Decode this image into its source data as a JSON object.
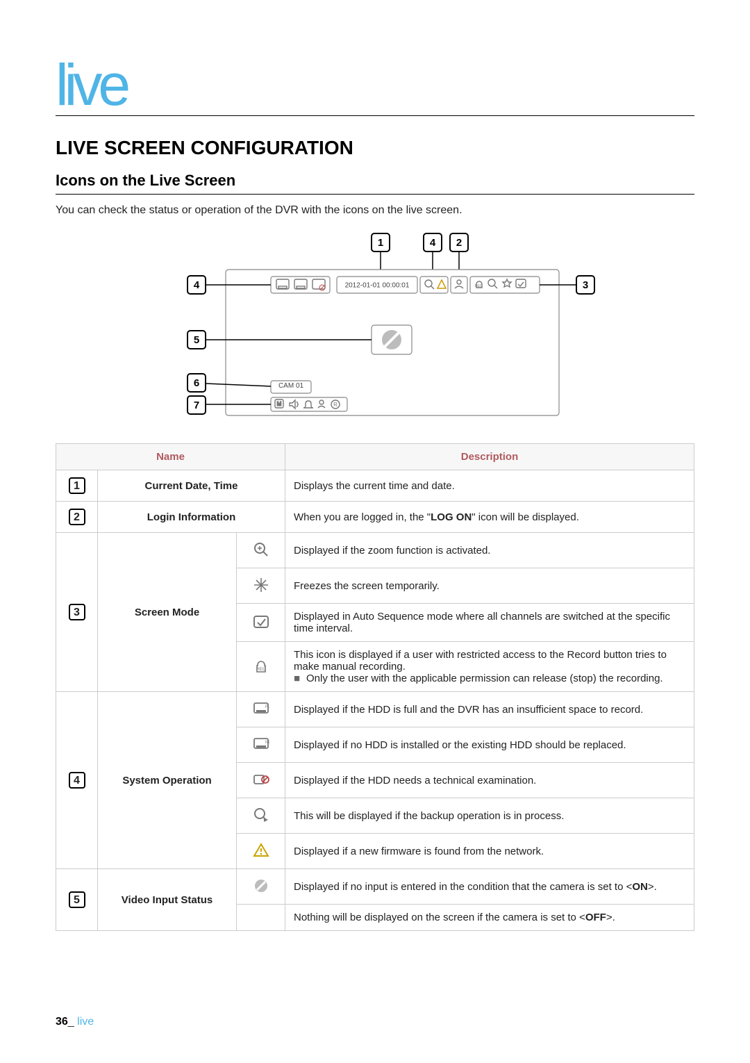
{
  "page": {
    "header": "live",
    "section_title": "LIVE SCREEN CONFIGURATION",
    "sub_title": "Icons on the Live Screen",
    "intro": "You can check the status or operation of the DVR with the icons on the live screen.",
    "footer_page": "36",
    "footer_sep": "_",
    "footer_label": "live"
  },
  "diagram": {
    "callout_1": "1",
    "callout_2": "2",
    "callout_3": "3",
    "callout_4_top": "4",
    "callout_4_left": "4",
    "callout_5": "5",
    "callout_6": "6",
    "callout_7": "7",
    "date_time": "2012-01-01  00:00:01",
    "cam_label": "CAM 01"
  },
  "table": {
    "head_name": "Name",
    "head_desc": "Description",
    "rows": [
      {
        "num": "1",
        "name": "Current Date, Time",
        "sub": [
          {
            "icon": null,
            "desc": "Displays the current time and date."
          }
        ]
      },
      {
        "num": "2",
        "name": "Login Information",
        "sub": [
          {
            "icon": null,
            "desc_prefix": "When you are logged in, the \"",
            "desc_bold": "LOG ON",
            "desc_suffix": "\" icon will be displayed."
          }
        ]
      },
      {
        "num": "3",
        "name": "Screen Mode",
        "sub": [
          {
            "icon": "zoom-icon",
            "desc": "Displayed if the zoom function is activated."
          },
          {
            "icon": "freeze-icon",
            "desc": "Freezes the screen temporarily."
          },
          {
            "icon": "sequence-icon",
            "desc": "Displayed in Auto Sequence mode where all channels are switched at the specific time interval."
          },
          {
            "icon": "rec-lock-icon",
            "desc": "This icon is displayed if a user with restricted access to the Record button tries to make manual recording.",
            "note": "Only the user with the applicable permission can release (stop) the recording."
          }
        ]
      },
      {
        "num": "4",
        "name": "System Operation",
        "sub": [
          {
            "icon": "hdd-full-icon",
            "desc": "Displayed if the HDD is full and the DVR has an insufficient space to record."
          },
          {
            "icon": "hdd-none-icon",
            "desc": "Displayed if no HDD is installed or the existing HDD should be replaced."
          },
          {
            "icon": "hdd-tech-icon",
            "desc": "Displayed if the HDD needs a technical examination."
          },
          {
            "icon": "backup-icon",
            "desc": "This will be displayed if the backup operation is in process."
          },
          {
            "icon": "firmware-icon",
            "desc": "Displayed if a new firmware is found from the network."
          }
        ]
      },
      {
        "num": "5",
        "name": "Video Input Status",
        "sub": [
          {
            "icon": "no-input-icon",
            "desc_prefix": "Displayed if no input is entered in the condition that the camera is set to <",
            "desc_bold": "ON",
            "desc_suffix": ">."
          },
          {
            "icon": "",
            "desc_prefix": "Nothing will be displayed on the screen if the camera is set to <",
            "desc_bold": "OFF",
            "desc_suffix": ">."
          }
        ]
      }
    ]
  }
}
